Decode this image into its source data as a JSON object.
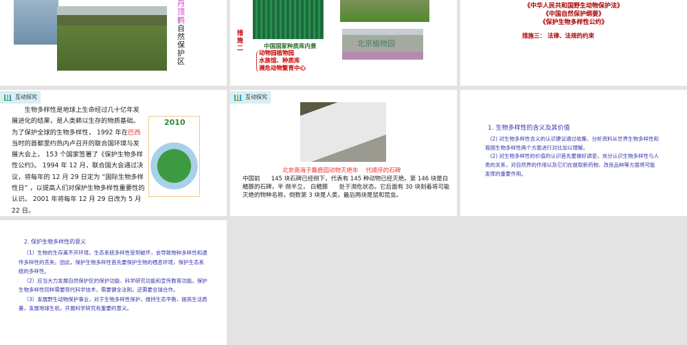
{
  "slides": [
    {
      "id": 1,
      "vertical_label_colored": "丹顶鹤",
      "vertical_label": "自然保护区"
    },
    {
      "id": 2,
      "measure_label": "措施二",
      "caption": "中国国家种质库内景",
      "list": [
        "动物园植物园",
        "水族馆、种质库",
        "濒危动物繁育中心"
      ],
      "sign_text": "北京植物园"
    },
    {
      "id": 3,
      "laws": [
        "《中华人民共和国野生动物保护法》",
        "《中国自然保护纲要》",
        "《保护生物多样性公约》"
      ],
      "measure": "措施三： 法律、法规的约束"
    },
    {
      "id": 4,
      "tag": "互动探究",
      "p1": "生物多样性是地球上生命经过几十亿年发展进化的结果，是人类赖以生存的物质基础。为了保护全球的生物多样性， 1992 年在",
      "highlight": "巴西",
      "p2": "当时的首都里约热内卢召开的联合国环境与发展大会上， 153 个国家签署了《保护生物多样性公约》。 1994 年 12 月，联合国大会通过决议，将每年的 12 月 29 日定为 “国际生物多样性日” ，以提高人们对保护生物多样性重要性的认识。 2001 年将每年 12 月 29 日改为 5 月 22 日。",
      "poster_year": "2010"
    },
    {
      "id": 5,
      "tag": "互动探究",
      "caption": "北京南海子麋鹿园动物灭绝年    代顺序的石碑",
      "text": "中国前      145 块石碑已经倒下，代表有 145 种动物已经灭绝。第 146 块是白鳍豚的石碑，半 倒半立， 白鳍豚      处于濒危状态。它后面有 30 块刻着将可能灭绝的物种名称，倒数第 3 块是人类，最后两块是鼠和昆虫。"
    },
    {
      "id": 6,
      "title": "1. 生物多样性的含义及其价值",
      "paras": [
        "(2) 对生物多样性含义的认识建议通过收集、分析资料从世界生物多样性和我国生物多样性两个方面进行对比加以理解。",
        "(2) 对生物多样性的价值的认识首先要做好调查，充分认识生物多样性与人类的关系，对自然界的作用以及它们在提取新药物、改良品种等方面将可能发挥的重要作用。"
      ]
    },
    {
      "id": 7,
      "title": "2. 保护生物多样性的意义",
      "paras": [
        "（1）生物的生存离不开环境，生态系统多样性受到破坏，会导致物种多样性和遗传多样性的丢失。因此，保护生物多样性首先要保护生物的栖息环境，保护生态系统的多样性。",
        "（2）应当大力发展自然保护区的保护功能、科学研究功能和宣传教育功能。保护生物多样性同样需要现代科学技术，需要健全法制，还需要全球合作。",
        "（3）发展野生动物保护事业，对于生物多样性保护，维持生态平衡，提高生活质量，发展地球生机，开展科学研究有重要的意义。"
      ]
    }
  ]
}
